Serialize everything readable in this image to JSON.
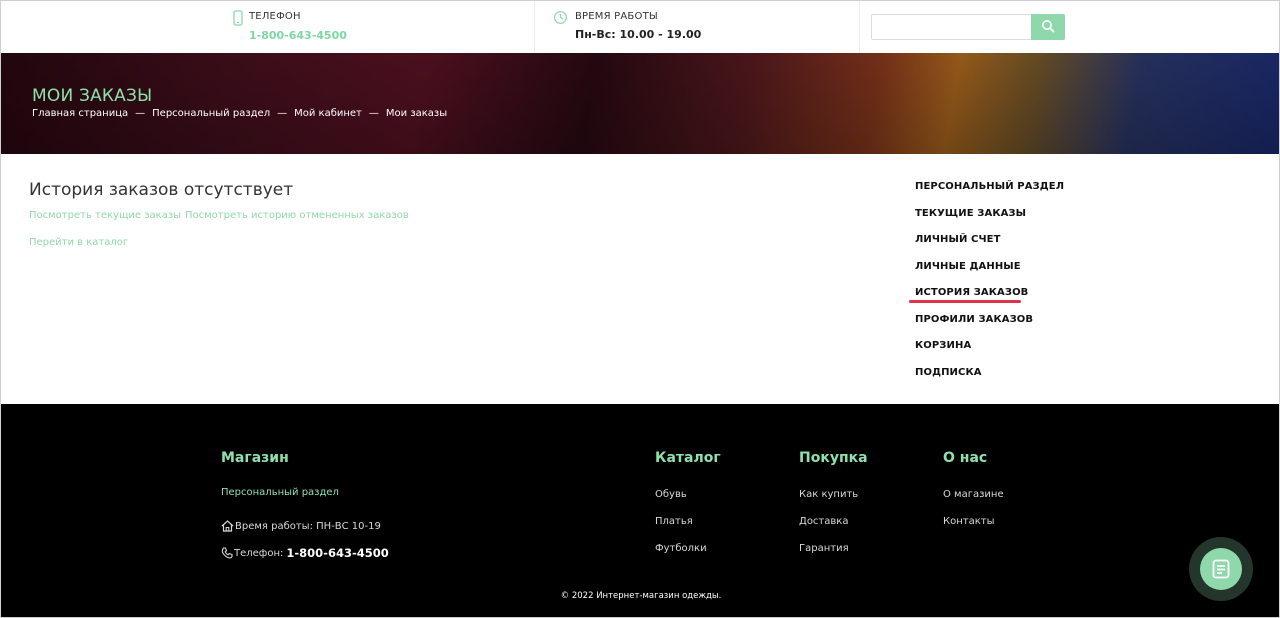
{
  "header": {
    "phone": {
      "label": "ТЕЛЕФОН",
      "value": "1-800-643-4500",
      "icon": "phone-icon"
    },
    "hours": {
      "label": "ВРЕМЯ РАБОТЫ",
      "value": "Пн-Вс: 10.00 - 19.00",
      "icon": "clock-icon"
    },
    "search": {
      "placeholder": "",
      "icon": "search-icon"
    }
  },
  "banner": {
    "title": "МОИ ЗАКАЗЫ",
    "breadcrumb": [
      "Главная страница",
      "Персональный раздел",
      "Мой кабинет",
      "Мои заказы"
    ],
    "separator": "—"
  },
  "main": {
    "empty_title": "История заказов отсутствует",
    "links": {
      "current_orders": "Посмотреть текущие заказы",
      "cancelled_history": "Посмотреть историю отмененных заказов",
      "catalog": "Перейти в каталог"
    }
  },
  "side_menu": {
    "items": [
      {
        "label": "ПЕРСОНАЛЬНЫЙ РАЗДЕЛ"
      },
      {
        "label": "ТЕКУЩИЕ ЗАКАЗЫ"
      },
      {
        "label": "ЛИЧНЫЙ СЧЕТ"
      },
      {
        "label": "ЛИЧНЫЕ ДАННЫЕ"
      },
      {
        "label": "ИСТОРИЯ ЗАКАЗОВ",
        "active": true
      },
      {
        "label": "ПРОФИЛИ ЗАКАЗОВ"
      },
      {
        "label": "КОРЗИНА"
      },
      {
        "label": "ПОДПИСКА"
      }
    ]
  },
  "footer": {
    "shop": {
      "heading": "Магазин",
      "personal_link": "Персональный раздел",
      "hours": "Время работы: ПН-ВС 10-19",
      "phone_label": "Телефон:",
      "phone_value": "1-800-643-4500"
    },
    "catalog": {
      "heading": "Каталог",
      "items": [
        "Обувь",
        "Платья",
        "Футболки"
      ]
    },
    "purchase": {
      "heading": "Покупка",
      "items": [
        "Как купить",
        "Доставка",
        "Гарантия"
      ]
    },
    "about": {
      "heading": "О нас",
      "items": [
        "О магазине",
        "Контакты"
      ]
    },
    "copyright": "© 2022 Интернет-магазин одежды."
  },
  "chat": {
    "icon": "chat-icon"
  },
  "colors": {
    "accent": "#8fd8ac",
    "active_underline": "#e0334a",
    "footer_bg": "#000000"
  }
}
